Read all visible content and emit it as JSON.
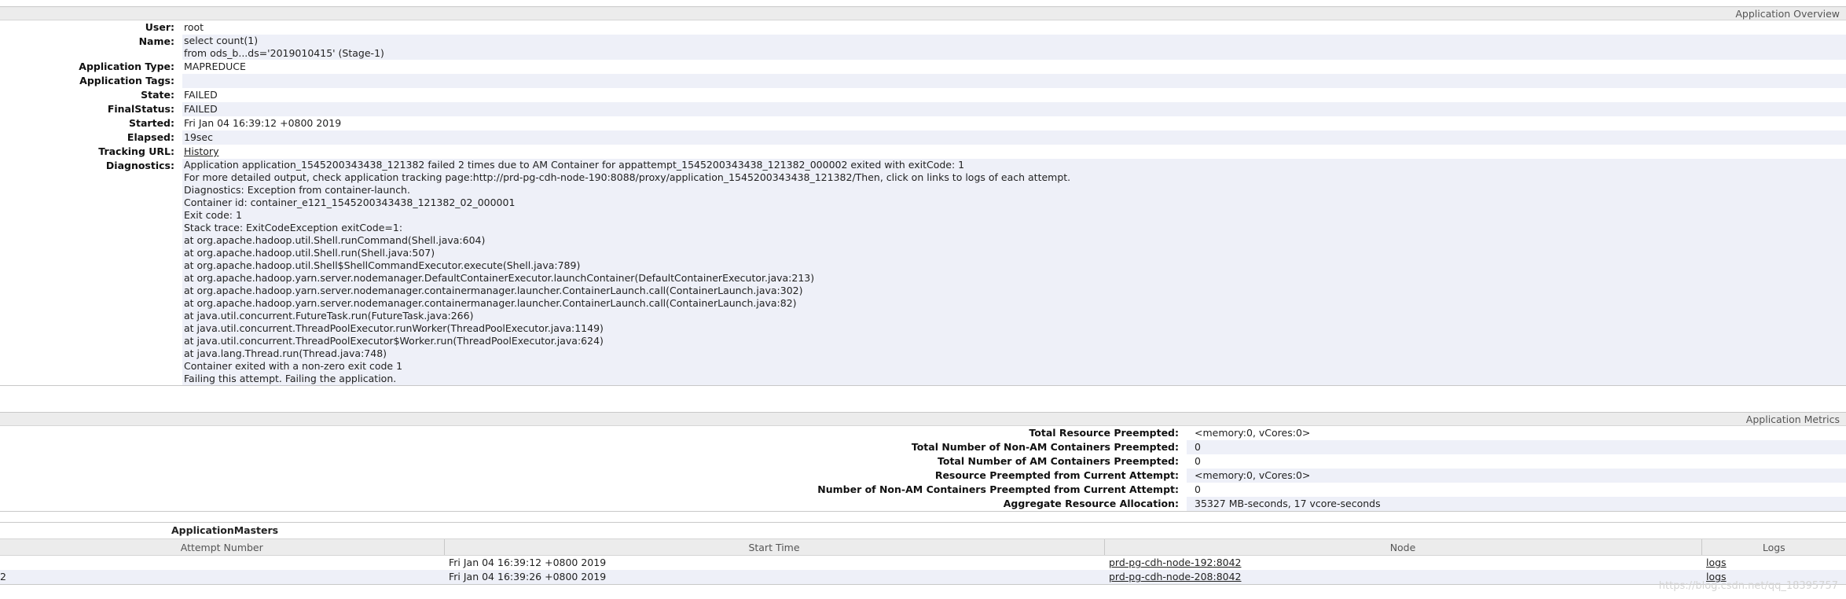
{
  "overview": {
    "header": "Application Overview",
    "rows": [
      {
        "label": "User:",
        "value": "root"
      },
      {
        "label": "Name:",
        "value": "select count(1)"
      },
      {
        "label": "",
        "value": "from ods_b...ds='2019010415' (Stage-1)"
      },
      {
        "label": "Application Type:",
        "value": "MAPREDUCE"
      },
      {
        "label": "Application Tags:",
        "value": ""
      },
      {
        "label": "State:",
        "value": "FAILED"
      },
      {
        "label": "FinalStatus:",
        "value": "FAILED"
      },
      {
        "label": "Started:",
        "value": "Fri Jan 04 16:39:12 +0800 2019"
      },
      {
        "label": "Elapsed:",
        "value": "19sec"
      }
    ],
    "tracking_url": {
      "label": "Tracking URL:",
      "link": "History"
    },
    "diagnostics": {
      "label": "Diagnostics:",
      "lines": [
        "Application application_1545200343438_121382 failed 2 times due to AM Container for appattempt_1545200343438_121382_000002 exited with exitCode: 1",
        "For more detailed output, check application tracking page:http://prd-pg-cdh-node-190:8088/proxy/application_1545200343438_121382/Then, click on links to logs of each attempt.",
        "Diagnostics: Exception from container-launch.",
        "Container id: container_e121_1545200343438_121382_02_000001",
        "Exit code: 1",
        "Stack trace: ExitCodeException exitCode=1:",
        "at org.apache.hadoop.util.Shell.runCommand(Shell.java:604)",
        "at org.apache.hadoop.util.Shell.run(Shell.java:507)",
        "at org.apache.hadoop.util.Shell$ShellCommandExecutor.execute(Shell.java:789)",
        "at org.apache.hadoop.yarn.server.nodemanager.DefaultContainerExecutor.launchContainer(DefaultContainerExecutor.java:213)",
        "at org.apache.hadoop.yarn.server.nodemanager.containermanager.launcher.ContainerLaunch.call(ContainerLaunch.java:302)",
        "at org.apache.hadoop.yarn.server.nodemanager.containermanager.launcher.ContainerLaunch.call(ContainerLaunch.java:82)",
        "at java.util.concurrent.FutureTask.run(FutureTask.java:266)",
        "at java.util.concurrent.ThreadPoolExecutor.runWorker(ThreadPoolExecutor.java:1149)",
        "at java.util.concurrent.ThreadPoolExecutor$Worker.run(ThreadPoolExecutor.java:624)",
        "at java.lang.Thread.run(Thread.java:748)",
        "Container exited with a non-zero exit code 1",
        "Failing this attempt. Failing the application."
      ]
    }
  },
  "metrics": {
    "header": "Application Metrics",
    "rows": [
      {
        "label": "Total Resource Preempted:",
        "value": "<memory:0, vCores:0>"
      },
      {
        "label": "Total Number of Non-AM Containers Preempted:",
        "value": "0"
      },
      {
        "label": "Total Number of AM Containers Preempted:",
        "value": "0"
      },
      {
        "label": "Resource Preempted from Current Attempt:",
        "value": "<memory:0, vCores:0>"
      },
      {
        "label": "Number of Non-AM Containers Preempted from Current Attempt:",
        "value": "0"
      },
      {
        "label": "Aggregate Resource Allocation:",
        "value": "35327 MB-seconds, 17 vcore-seconds"
      }
    ]
  },
  "masters": {
    "title": "ApplicationMasters",
    "columns": [
      "Attempt Number",
      "Start Time",
      "Node",
      "Logs"
    ],
    "rows": [
      {
        "attempt": "",
        "start": "Fri Jan 04 16:39:12 +0800 2019",
        "node": "prd-pg-cdh-node-192:8042",
        "logs": "logs"
      },
      {
        "attempt": "2",
        "start": "Fri Jan 04 16:39:26 +0800 2019",
        "node": "prd-pg-cdh-node-208:8042",
        "logs": "logs"
      }
    ]
  },
  "watermark": "https://blog.csdn.net/qq_18395757"
}
